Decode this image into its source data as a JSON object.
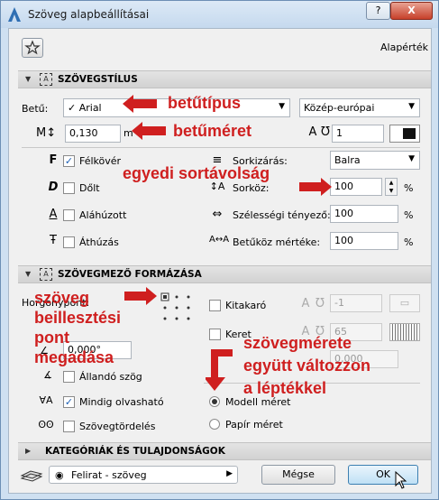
{
  "window": {
    "title": "Szöveg alapbeállításai",
    "help_label": "?",
    "close_label": "X"
  },
  "top": {
    "default_label": "Alapérték"
  },
  "sections": {
    "style": "SZÖVEGSTÍLUS",
    "frame": "SZÖVEGMEZŐ FORMÁZÁSA",
    "categories": "KATEGÓRIÁK ÉS TULAJDONSÁGOK"
  },
  "font": {
    "label": "Betű:",
    "value": "✓ Arial",
    "encoding": "Közép-európai"
  },
  "size": {
    "value": "0,130",
    "unit": "m",
    "pen_value": "1"
  },
  "styles": {
    "bold": "Félkövér",
    "italic": "Dőlt",
    "underline": "Aláhúzott",
    "strike": "Áthúzás"
  },
  "para": {
    "justify_label": "Sorkizárás:",
    "justify_value": "Balra",
    "spacing_label": "Sorköz:",
    "spacing_value": "100",
    "width_label": "Szélességi tényező:",
    "width_value": "100",
    "letter_label": "Betűköz mértéke:",
    "letter_value": "100",
    "pct": "%"
  },
  "frame": {
    "anchor_label": "Horgonypont:",
    "frame_label": "Kitakaró",
    "frame_value": "-1",
    "border_label": "Keret",
    "border_value": "65",
    "offset_value": "0,000",
    "angle_value": "0,000°",
    "fixed_angle": "Állandó szög",
    "readable": "Mindig olvasható",
    "wrap": "Szövegtördelés",
    "model_size": "Modell méret",
    "paper_size": "Papír méret"
  },
  "footer": {
    "layer": "Felirat - szöveg",
    "cancel": "Mégse",
    "ok": "OK"
  },
  "annotations": {
    "font_type": "betűtípus",
    "font_size": "betűméret",
    "line_spacing": "egyedi sortávolság",
    "anchor_line1": "szöveg",
    "anchor_line2": "beillesztési",
    "anchor_line3": "pont",
    "anchor_line4": "megadása",
    "scale_line1": "szövegmérete",
    "scale_line2": "együtt változzon",
    "scale_line3": "a léptékkel"
  },
  "colors": {
    "accent": "#cf1f1f",
    "title_bg": "#cfe0f1",
    "ok_bg": "#bfe0f5"
  }
}
